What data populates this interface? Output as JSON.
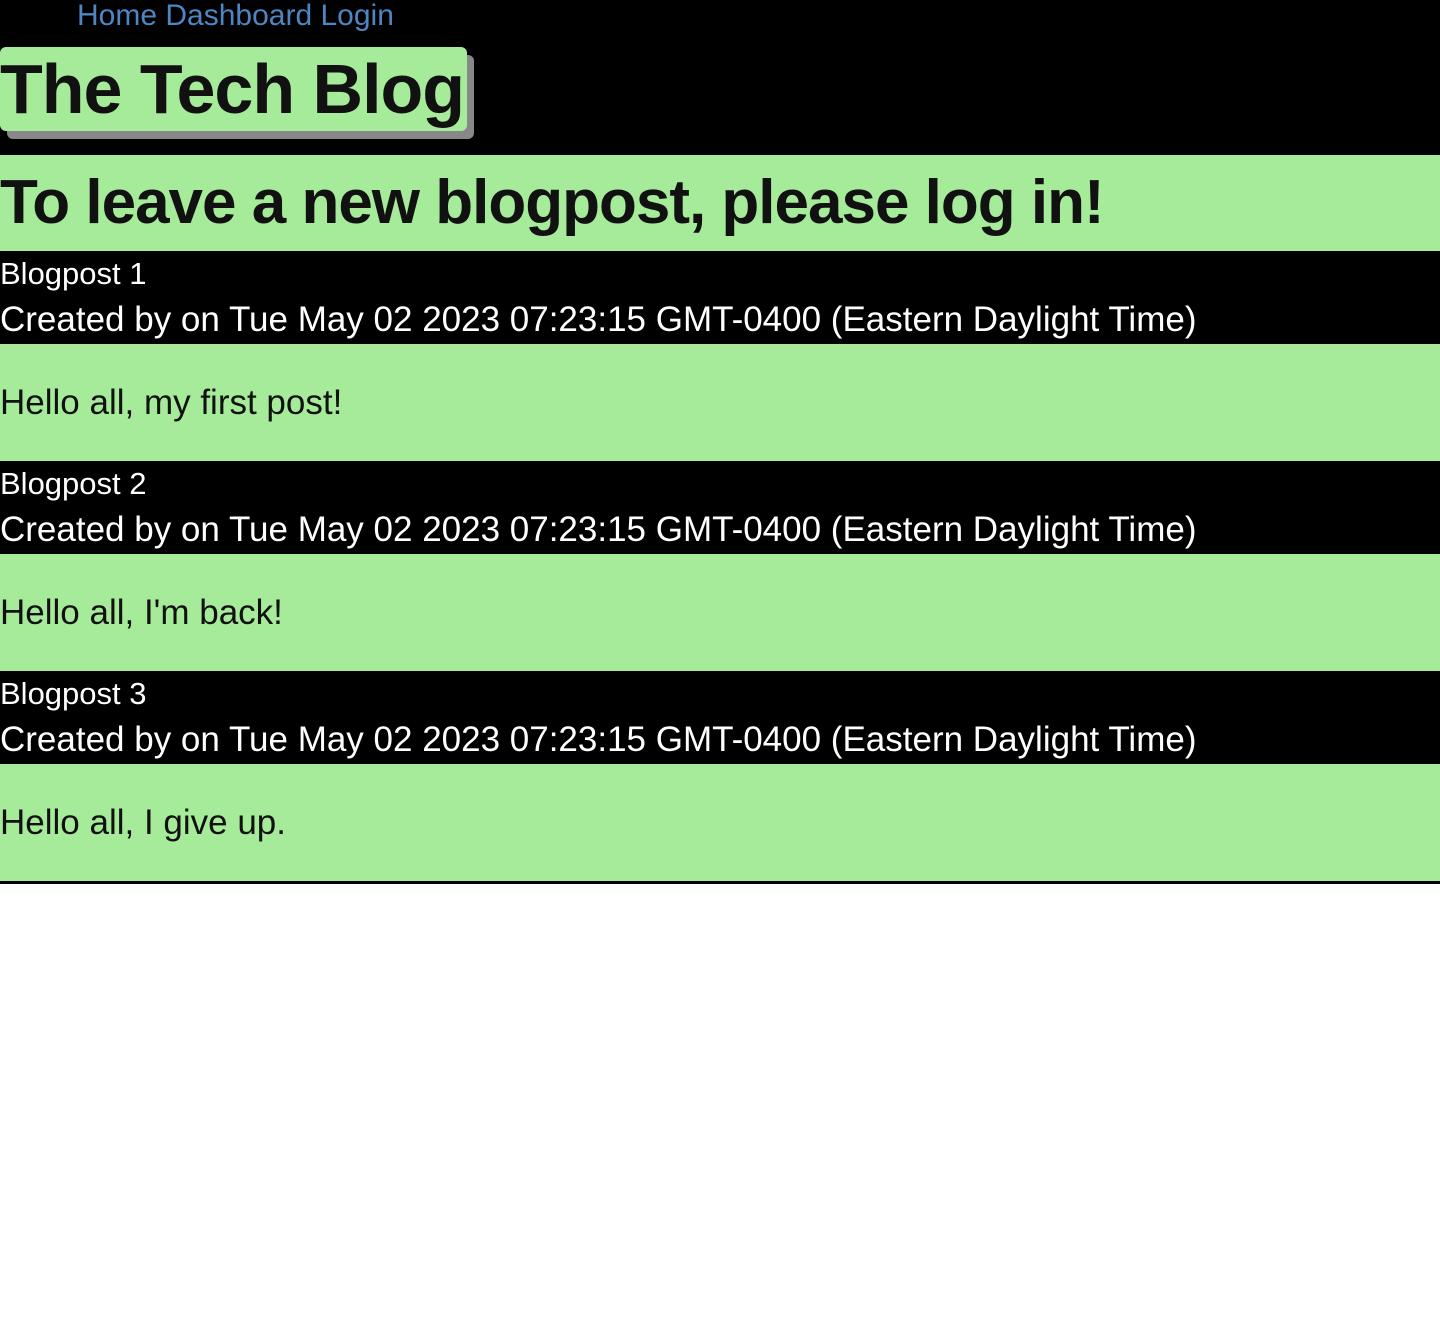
{
  "nav": {
    "home": "Home",
    "dashboard": "Dashboard",
    "login": "Login"
  },
  "site_title": "The Tech Blog",
  "banner": "To leave a new blogpost, please log in!",
  "posts": [
    {
      "title": "Blogpost 1",
      "meta": "Created by on Tue May 02 2023 07:23:15 GMT-0400 (Eastern Daylight Time)",
      "content": "Hello all, my first post!"
    },
    {
      "title": "Blogpost 2",
      "meta": "Created by on Tue May 02 2023 07:23:15 GMT-0400 (Eastern Daylight Time)",
      "content": "Hello all, I'm back!"
    },
    {
      "title": "Blogpost 3",
      "meta": "Created by on Tue May 02 2023 07:23:15 GMT-0400 (Eastern Daylight Time)",
      "content": "Hello all, I give up."
    }
  ],
  "colors": {
    "header_bg": "#000000",
    "accent_green": "#a6eb99",
    "link_blue": "#4d86c2",
    "text_dark": "#111111"
  }
}
